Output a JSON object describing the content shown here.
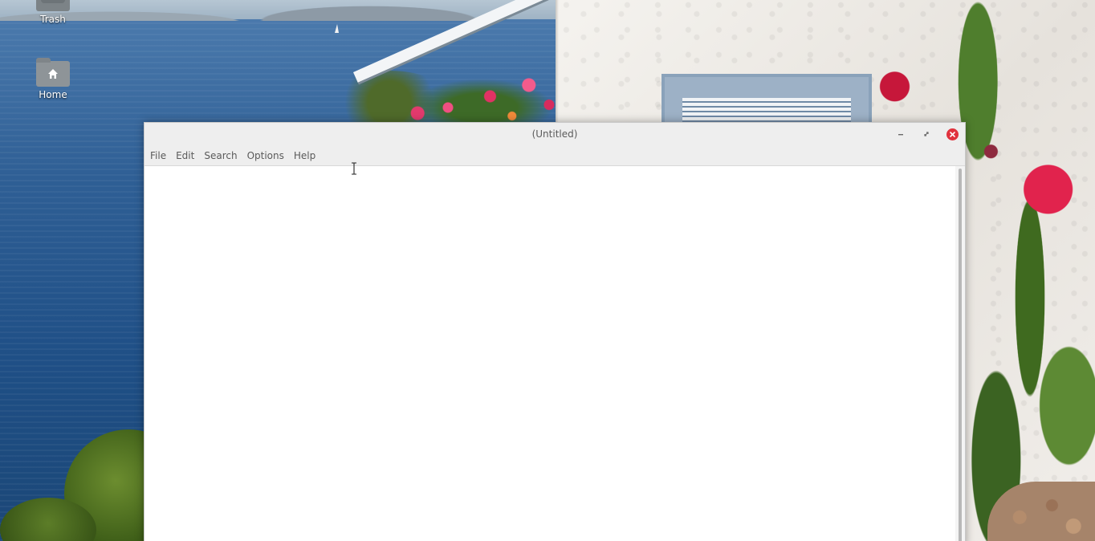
{
  "desktop": {
    "icons": [
      {
        "label": "Trash",
        "icon": "trash-icon"
      },
      {
        "label": "Home",
        "icon": "home-folder-icon"
      }
    ]
  },
  "window": {
    "title": "(Untitled)",
    "controls": {
      "minimize": "minimize-icon",
      "maximize": "maximize-icon",
      "close": "close-icon"
    },
    "menu": [
      "File",
      "Edit",
      "Search",
      "Options",
      "Help"
    ],
    "editor": {
      "text": ""
    },
    "colors": {
      "close_button": "#e0323d",
      "titlebar_bg": "#eeeeee",
      "menu_text": "#5a5a5a"
    }
  }
}
